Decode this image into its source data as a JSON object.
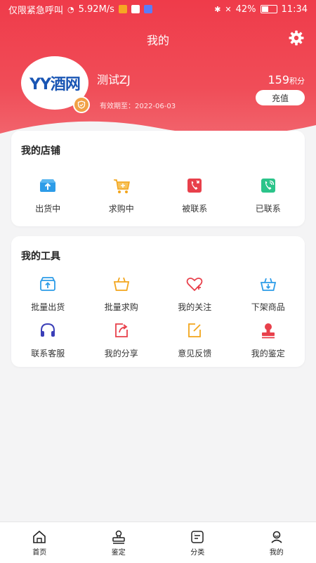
{
  "status_bar": {
    "carrier": "仅限紧急呼叫",
    "network_speed": "5.92M/s",
    "battery_percent": "42%",
    "time": "11:34"
  },
  "header": {
    "title": "我的"
  },
  "profile": {
    "username": "测试ZJ",
    "expiry": "有效期至：2022-06-03",
    "points_value": "159",
    "points_unit": "积分",
    "recharge_label": "充值",
    "avatar_logo_text": "YY酒网"
  },
  "my_store": {
    "title": "我的店铺",
    "items": [
      {
        "label": "出货中",
        "icon": "shipping-box-icon",
        "color": "#2d9ce8"
      },
      {
        "label": "求购中",
        "icon": "cart-icon",
        "color": "#f2a51c"
      },
      {
        "label": "被联系",
        "icon": "phone-incoming-icon",
        "color": "#e8404b"
      },
      {
        "label": "已联系",
        "icon": "phone-outgoing-icon",
        "color": "#2bc48a"
      }
    ]
  },
  "my_tools": {
    "title": "我的工具",
    "items": [
      {
        "label": "批量出货",
        "icon": "bulk-ship-icon",
        "color": "#2d9ce8"
      },
      {
        "label": "批量求购",
        "icon": "basket-icon",
        "color": "#f2a51c"
      },
      {
        "label": "我的关注",
        "icon": "heart-plus-icon",
        "color": "#e8404b"
      },
      {
        "label": "下架商品",
        "icon": "unshelve-icon",
        "color": "#2d9ce8"
      },
      {
        "label": "联系客服",
        "icon": "headset-icon",
        "color": "#3b3fb8"
      },
      {
        "label": "我的分享",
        "icon": "share-icon",
        "color": "#e8404b"
      },
      {
        "label": "意见反馈",
        "icon": "feedback-icon",
        "color": "#f2a51c"
      },
      {
        "label": "我的鉴定",
        "icon": "appraisal-stamp-icon",
        "color": "#e8404b"
      }
    ]
  },
  "tabbar": {
    "items": [
      {
        "label": "首页",
        "icon": "home-icon"
      },
      {
        "label": "鉴定",
        "icon": "stamp-icon"
      },
      {
        "label": "分类",
        "icon": "category-icon"
      },
      {
        "label": "我的",
        "icon": "user-icon"
      }
    ]
  },
  "colors": {
    "primary": "#ef3b4a",
    "background": "#f4f4f5"
  }
}
